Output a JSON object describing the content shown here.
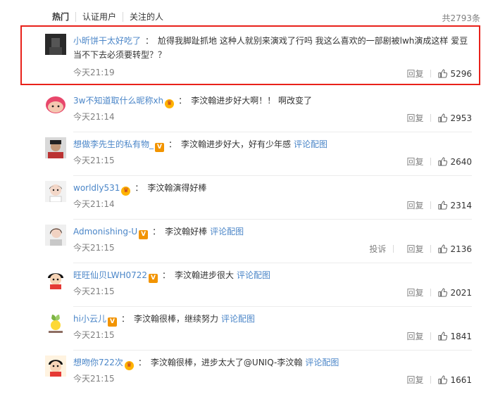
{
  "tabs": [
    "热门",
    "认证用户",
    "关注的人"
  ],
  "total": "共2793条",
  "icons": {
    "like": "thumb-up-icon",
    "badge_crown": "crown-badge-icon",
    "badge_vip": "vip-badge-icon"
  },
  "colors": {
    "username": "#4b86c8",
    "highlight": "#e8211a",
    "time": "#808080"
  },
  "comments": [
    {
      "user": "小昕饼干太好吃了",
      "badge": "",
      "text": "尬得我脚趾抓地 这种人就别来演戏了行吗 我这么喜欢的一部剧被lwh演成这样 爱豆当不下去必须要转型？？",
      "link": "",
      "time": "今天21:19",
      "report": "",
      "reply": "回复",
      "likes": "5296"
    },
    {
      "user": "3w不知道取什么昵称xh",
      "badge": "crown",
      "text": "李汶翰进步好大啊！！ 啊改变了",
      "link": "",
      "time": "今天21:14",
      "report": "",
      "reply": "回复",
      "likes": "2953"
    },
    {
      "user": "想做李先生的私有物_",
      "badge": "vip",
      "text": "李汶翰进步好大，好有少年感",
      "link": "评论配图",
      "time": "今天21:15",
      "report": "",
      "reply": "回复",
      "likes": "2640"
    },
    {
      "user": "worldly531",
      "badge": "crown",
      "text": "李汶翰演得好棒",
      "link": "",
      "time": "今天21:14",
      "report": "",
      "reply": "回复",
      "likes": "2314"
    },
    {
      "user": "Admonishing-U",
      "badge": "vip",
      "text": "李汶翰好棒",
      "link": "评论配图",
      "time": "今天21:15",
      "report": "投诉",
      "reply": "回复",
      "likes": "2136"
    },
    {
      "user": "旺旺仙贝LWH0722",
      "badge": "vip",
      "text": "李汶翰进步很大",
      "link": "评论配图",
      "time": "今天21:15",
      "report": "",
      "reply": "回复",
      "likes": "2021"
    },
    {
      "user": "hi小云儿",
      "badge": "vip",
      "text": "李汶翰很棒，继续努力",
      "link": "评论配图",
      "time": "今天21:15",
      "report": "",
      "reply": "回复",
      "likes": "1841"
    },
    {
      "user": "想吻你722次",
      "badge": "crown",
      "text": "李汶翰很棒，进步太大了@UNIQ-李汶翰",
      "link": "评论配图",
      "time": "今天21:15",
      "report": "",
      "reply": "回复",
      "likes": "1661"
    }
  ]
}
